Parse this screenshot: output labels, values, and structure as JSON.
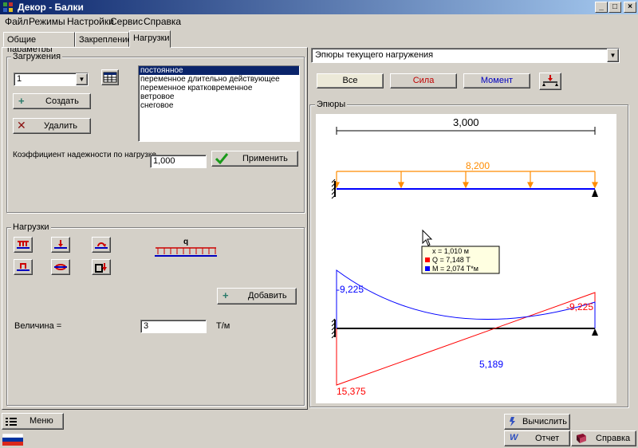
{
  "window": {
    "title": "Декор - Балки"
  },
  "menu": [
    "Файл",
    "Режимы",
    "Настройки",
    "Сервис",
    "Справка"
  ],
  "tabs": [
    "Общие параметры",
    "Закрепление",
    "Нагрузки"
  ],
  "loadings": {
    "group_label": "Загружения",
    "combo_value": "1",
    "create_label": "Создать",
    "delete_label": "Удалить",
    "types": [
      "постоянное",
      "переменное длительно действующее",
      "переменное кратковременное",
      "ветровое",
      "снеговое"
    ],
    "selected_index": 0,
    "coef_label": "Коэффициент надежности по нагрузке",
    "coef_value": "1,000",
    "apply_label": "Применить"
  },
  "loads": {
    "group_label": "Нагрузки",
    "preview_label": "q",
    "add_label": "Добавить",
    "value_label": "Величина =",
    "value": "3",
    "unit": "Т/м"
  },
  "diagrams": {
    "mode_select": "Эпюры текущего нагружения",
    "filter_all": "Все",
    "filter_force": "Сила",
    "filter_moment": "Момент",
    "group_label": "Эпюры",
    "span_label": "3,000",
    "load_label": "8,200",
    "tooltip": {
      "x": "x = 1,010 м",
      "q": "Q = 7,148 Т",
      "m": "M = 2,074 Т*м"
    },
    "labels": {
      "m_left": "-9,225",
      "m_right": "-9,225",
      "m_mid": "5,189",
      "q_left": "15,375"
    },
    "colors": {
      "load": "#ff8c00",
      "beam": "#0000ff",
      "shear": "#ff0000",
      "moment": "#0000ff"
    }
  },
  "bottom": {
    "menu_label": "Меню",
    "calc_label": "Вычислить",
    "report_label": "Отчет",
    "help_label": "Справка"
  }
}
